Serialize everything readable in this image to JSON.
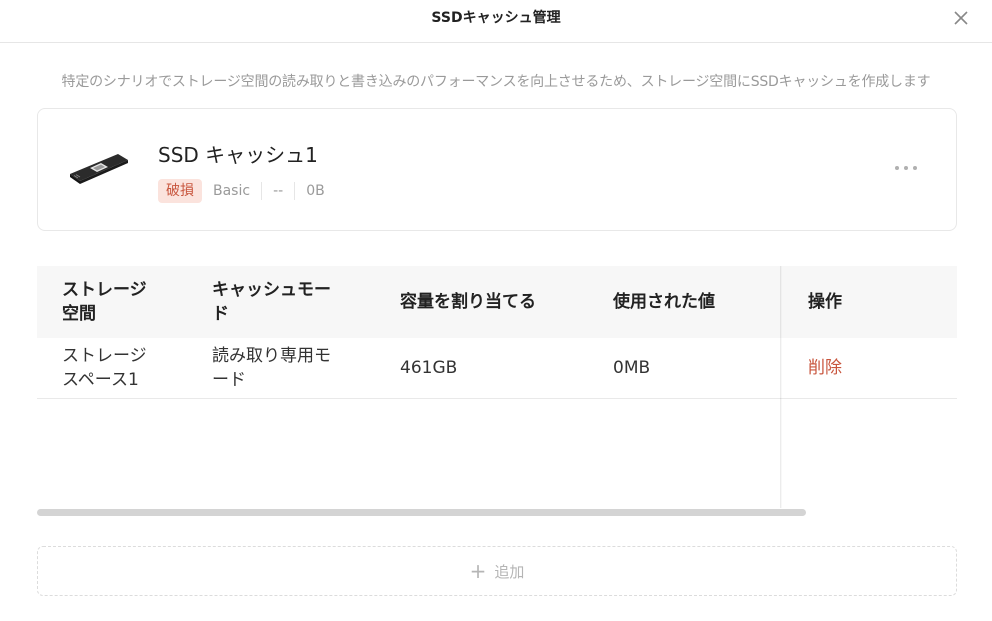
{
  "dialog": {
    "title": "SSDキャッシュ管理",
    "description": "特定のシナリオでストレージ空間の読み取りと書き込みのパフォーマンスを向上させるため、ストレージ空間にSSDキャッシュを作成します"
  },
  "cache": {
    "name": "SSD キャッシュ1",
    "status": "破損",
    "raid_type": "Basic",
    "health": "--",
    "size": "0B",
    "status_color": "#c8553d"
  },
  "table": {
    "headers": {
      "storage": "ストレージ空間",
      "mode": "キャッシュモード",
      "allocated": "容量を割り当てる",
      "used": "使用された値",
      "actions": "操作"
    },
    "rows": [
      {
        "storage": "ストレージスペース1",
        "mode": "読み取り専用モード",
        "allocated": "461GB",
        "used": "0MB",
        "action": "削除"
      }
    ]
  },
  "add_button": {
    "icon": "plus-icon",
    "label": "追加"
  },
  "colors": {
    "accent": "#c8553d",
    "muted_text": "#9a9a9a"
  }
}
